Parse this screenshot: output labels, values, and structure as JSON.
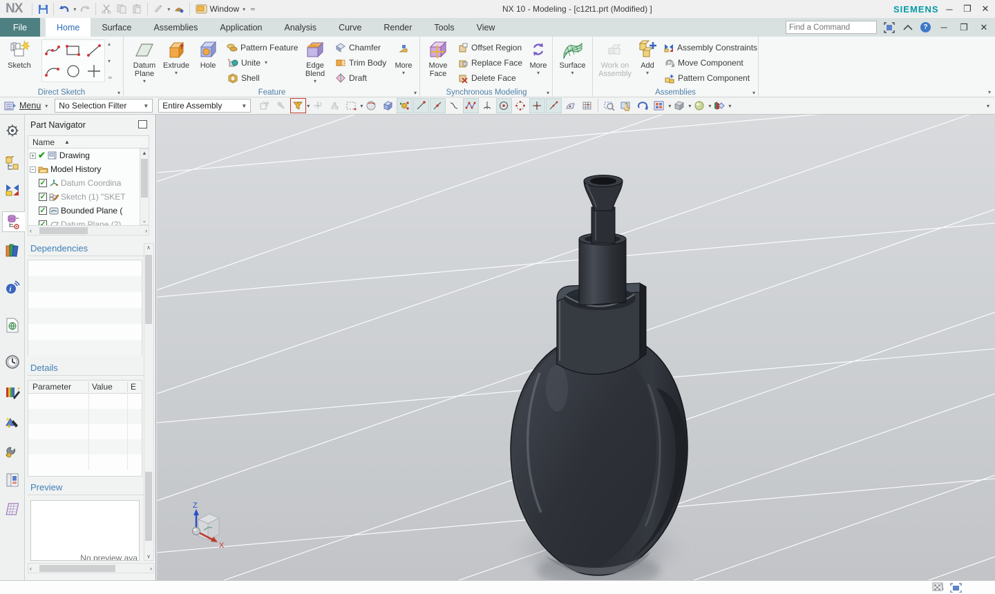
{
  "titlebar": {
    "logo": "NX",
    "window_label": "Window",
    "title": "NX 10 - Modeling - [c12t1.prt (Modified) ]",
    "brand": "SIEMENS"
  },
  "tabs": {
    "items": [
      {
        "label": "File"
      },
      {
        "label": "Home"
      },
      {
        "label": "Surface"
      },
      {
        "label": "Assemblies"
      },
      {
        "label": "Application"
      },
      {
        "label": "Analysis"
      },
      {
        "label": "Curve"
      },
      {
        "label": "Render"
      },
      {
        "label": "Tools"
      },
      {
        "label": "View"
      }
    ],
    "find_command_placeholder": "Find a Command"
  },
  "ribbon": {
    "direct_sketch": {
      "label": "Direct Sketch",
      "sketch": "Sketch"
    },
    "feature": {
      "label": "Feature",
      "datum_plane": "Datum Plane",
      "extrude": "Extrude",
      "hole": "Hole",
      "pattern_feature": "Pattern Feature",
      "unite": "Unite",
      "shell": "Shell",
      "edge_blend": "Edge Blend",
      "chamfer": "Chamfer",
      "trim_body": "Trim Body",
      "draft": "Draft",
      "more": "More"
    },
    "sync": {
      "label": "Synchronous Modeling",
      "move_face": "Move Face",
      "offset_region": "Offset Region",
      "replace_face": "Replace Face",
      "delete_face": "Delete Face",
      "more": "More"
    },
    "surface": {
      "label": "Surface"
    },
    "assemblies": {
      "label": "Assemblies",
      "work_on": "Work on Assembly",
      "add": "Add",
      "constraints": "Assembly Constraints",
      "move_component": "Move Component",
      "pattern_component": "Pattern Component"
    }
  },
  "selection_bar": {
    "menu": "Menu",
    "filter_value": "No Selection Filter",
    "scope_value": "Entire Assembly"
  },
  "resource_bar": {
    "items": [
      {
        "name": "roller-gear"
      },
      {
        "name": "assembly-navigator"
      },
      {
        "name": "constraint-navigator"
      },
      {
        "name": "part-navigator"
      },
      {
        "name": "reuse-library"
      },
      {
        "name": "hd3d-tools"
      },
      {
        "name": "web-browser"
      },
      {
        "name": "history"
      },
      {
        "name": "system-scenes"
      },
      {
        "name": "system-visualization"
      },
      {
        "name": "wizards"
      },
      {
        "name": "roles"
      },
      {
        "name": "templates"
      }
    ]
  },
  "part_navigator": {
    "title": "Part Navigator",
    "name_column": "Name",
    "tree": [
      {
        "label": "Drawing"
      },
      {
        "label": "Model History"
      },
      {
        "label": "Datum Coordina"
      },
      {
        "label": "Sketch (1) \"SKET"
      },
      {
        "label": "Bounded Plane ("
      },
      {
        "label": "Datum Plane (2)"
      }
    ],
    "dependencies_title": "Dependencies",
    "details_title": "Details",
    "details_columns": {
      "parameter": "Parameter",
      "value": "Value",
      "expression": "E"
    },
    "preview_title": "Preview",
    "no_preview_text": "No preview ava"
  },
  "viewport": {
    "model_name": "bottle-solid-model",
    "triad": {
      "z_label": "Z",
      "x_label": "X"
    },
    "background_top": "#d8dadd",
    "background_bottom": "#c2c4c8",
    "model_color": "#2f3338"
  },
  "icons": {
    "save": "floppy-disk",
    "undo": "curved-arrow-left",
    "redo": "curved-arrow-right",
    "cut": "scissors",
    "copy": "two-sheets",
    "paste": "clipboard",
    "find": "magnifier",
    "help": "question-circle",
    "menu": "list-lines",
    "accent_teal": "#019aa8",
    "tab_blue": "#2b6cb5",
    "group_label_blue": "#4c7fa8"
  }
}
